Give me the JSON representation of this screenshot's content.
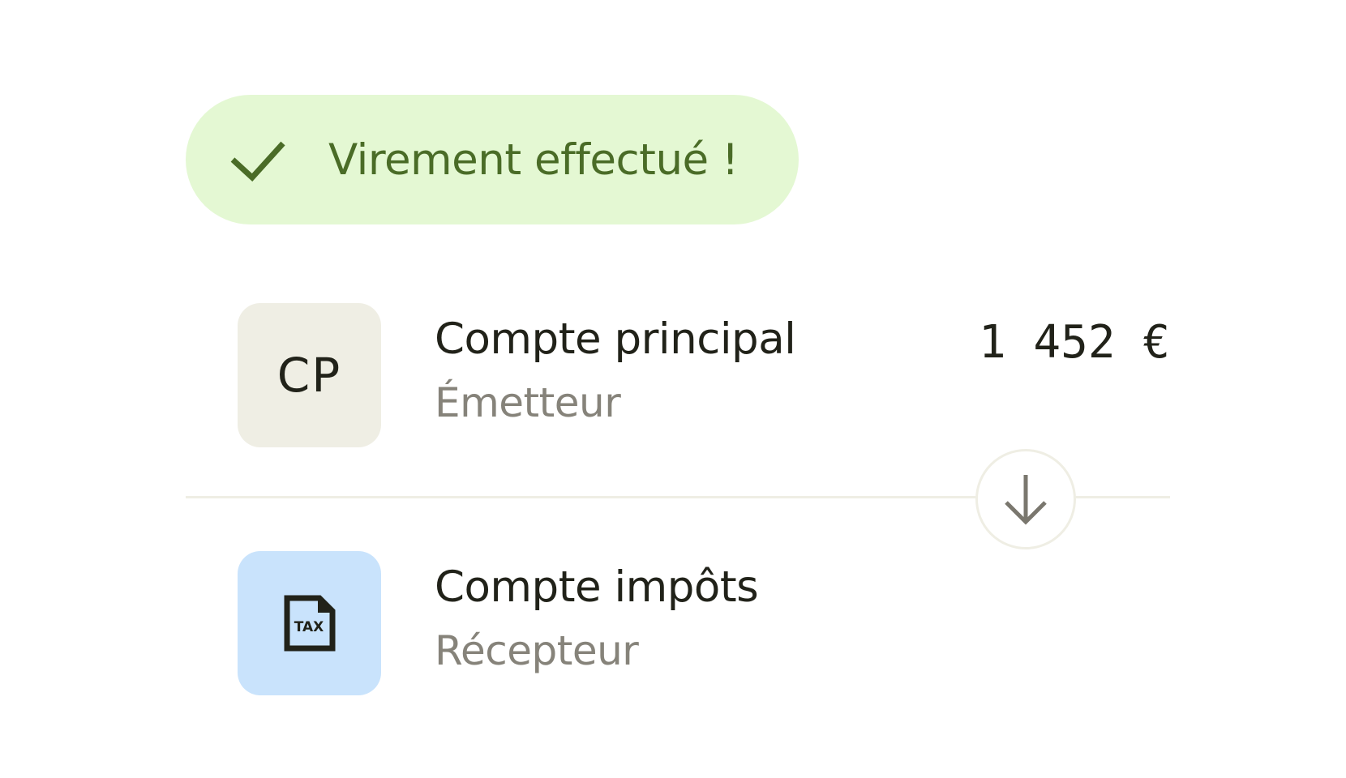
{
  "status": {
    "message": "Virement effectué !",
    "icon": "check-icon",
    "color": "#4a6c27",
    "background": "#e4f8d3"
  },
  "transfer": {
    "sender": {
      "initials": "CP",
      "name": "Compte principal",
      "role": "Émetteur",
      "amount": "1 452 €"
    },
    "direction_icon": "arrow-down-icon",
    "receiver": {
      "icon": "tax-document-icon",
      "icon_label": "TAX",
      "name": "Compte impôts",
      "role": "Récepteur"
    }
  }
}
